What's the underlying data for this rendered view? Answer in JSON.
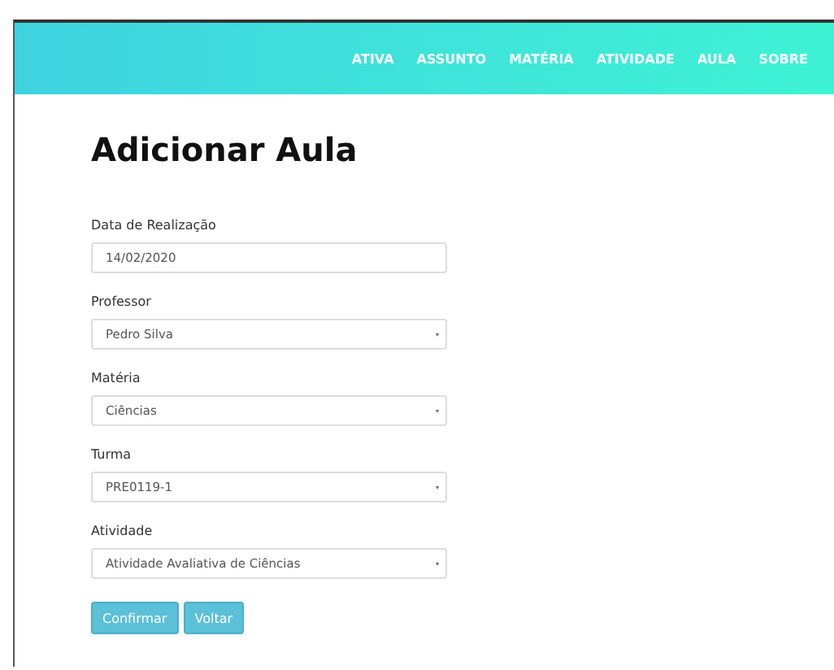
{
  "nav": {
    "items": [
      {
        "label": "ATIVA"
      },
      {
        "label": "ASSUNTO"
      },
      {
        "label": "MATÉRIA"
      },
      {
        "label": "ATIVIDADE"
      },
      {
        "label": "AULA"
      },
      {
        "label": "SOBRE"
      }
    ]
  },
  "title": "Adicionar Aula",
  "fields": [
    {
      "label": "Data de Realização",
      "kind": "text",
      "value": "14/02/2020"
    },
    {
      "label": "Professor",
      "kind": "select",
      "value": "Pedro Silva"
    },
    {
      "label": "Matéria",
      "kind": "select",
      "value": "Ciências"
    },
    {
      "label": "Turma",
      "kind": "select",
      "value": "PRE0119-1"
    },
    {
      "label": "Atividade",
      "kind": "select",
      "value": "Atividade Avaliativa de Ciências"
    }
  ],
  "buttons": [
    "Confirmar",
    "Voltar"
  ]
}
